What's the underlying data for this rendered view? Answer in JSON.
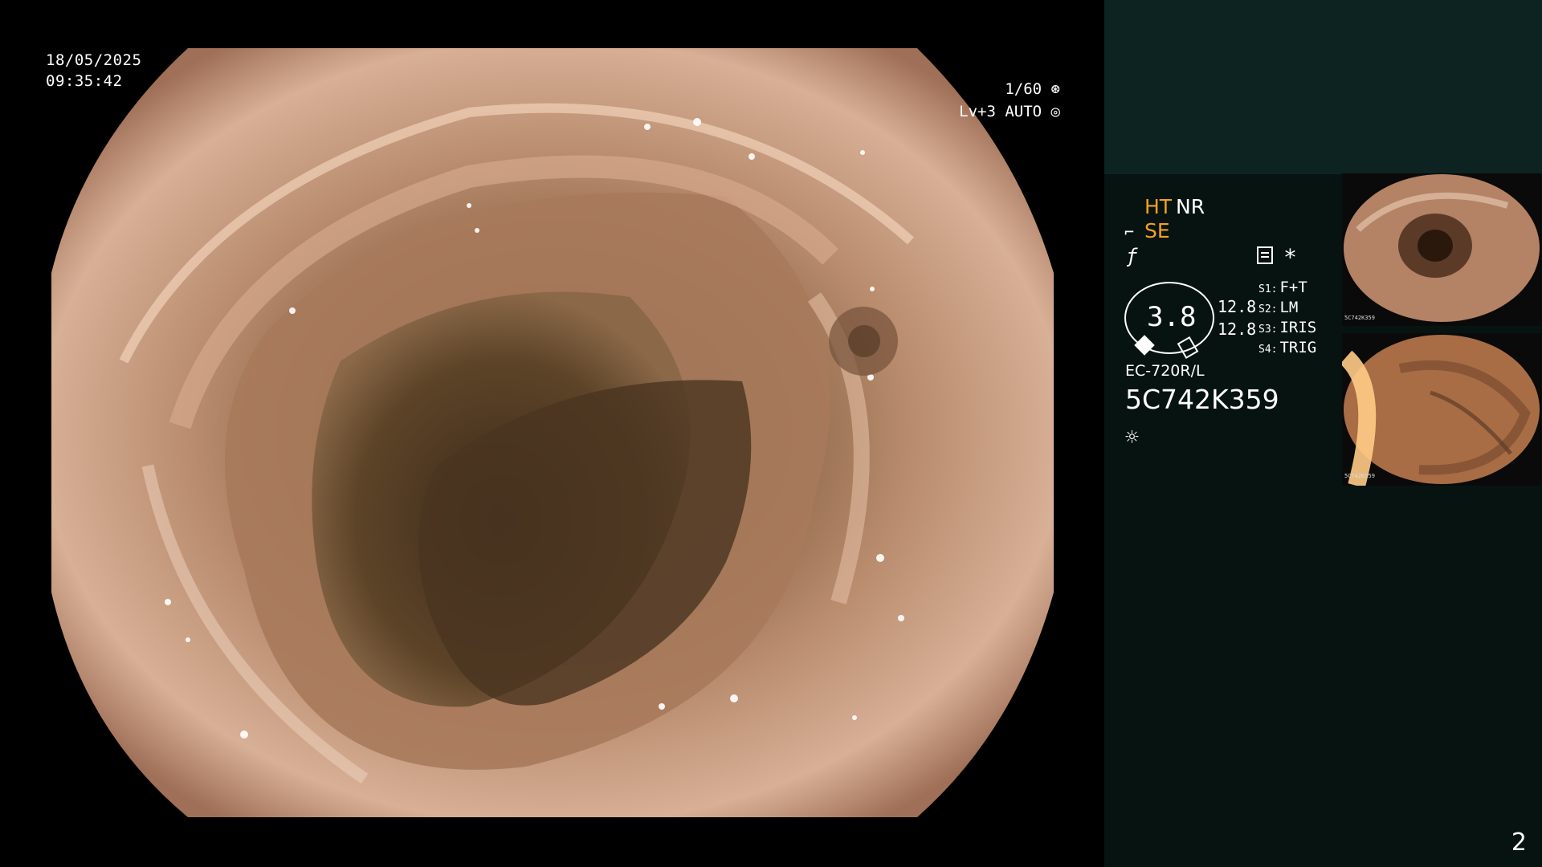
{
  "overlay": {
    "date": "18/05/2025",
    "time": "09:35:42",
    "shutter": "1/60",
    "level": "Lv+3 AUTO"
  },
  "panel": {
    "ht": "HT",
    "nr": "NR",
    "se": "SE",
    "gauge_value": "3.8",
    "value_1": "12.8",
    "value_2": "12.8",
    "s1_key": "S1:",
    "s1_value": "F+T",
    "s2_key": "S2:",
    "s2_value": "LM",
    "s3_key": "S3:",
    "s3_value": "IRIS",
    "s4_key": "S4:",
    "s4_value": "TRIG",
    "model": "EC-720R/L",
    "serial": "5C742K359",
    "page_number": "2"
  },
  "thumbnails": {
    "first_label": "5C742K359",
    "second_label": "5C742K359"
  },
  "icons": [
    "shutter-icon",
    "auto-icon",
    "se-icon",
    "f-icon",
    "document-icon",
    "star-icon",
    "brightness-icon"
  ],
  "colors": {
    "accent": "#f2a11b",
    "panel_top": "#0c2322",
    "panel": "#071311"
  }
}
